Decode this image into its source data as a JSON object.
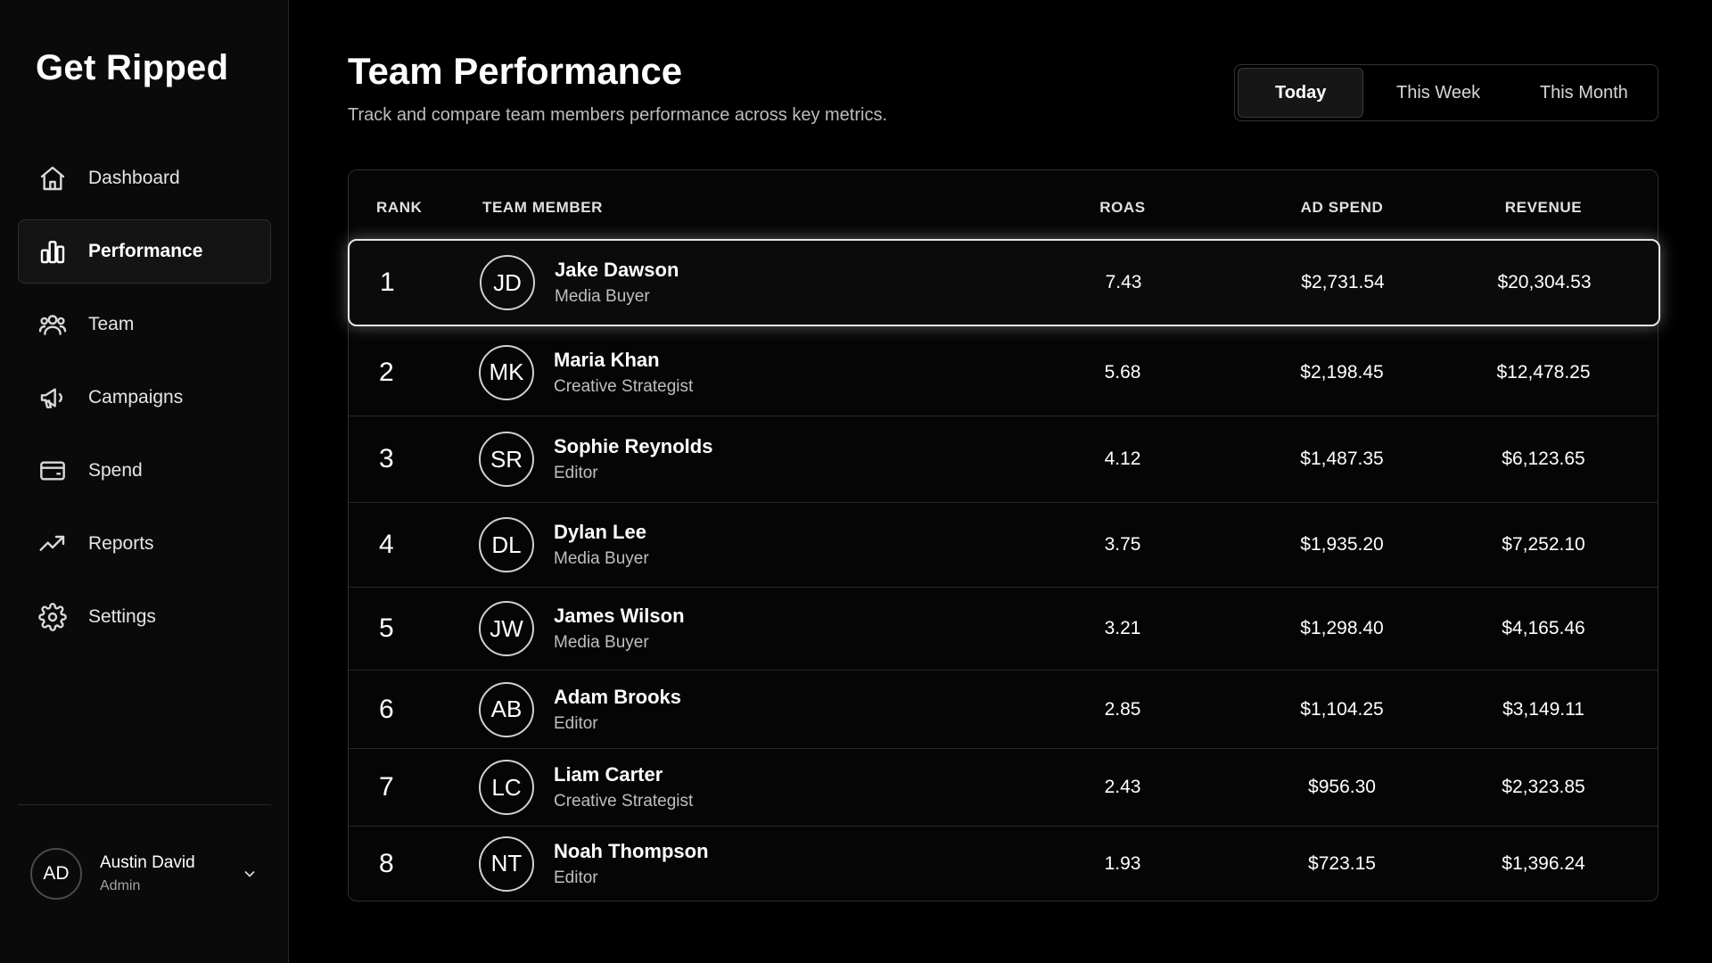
{
  "app": {
    "brand": "Get Ripped"
  },
  "sidebar": {
    "items": [
      {
        "label": "Dashboard",
        "icon": "home-icon",
        "active": false
      },
      {
        "label": "Performance",
        "icon": "bar-chart-icon",
        "active": true
      },
      {
        "label": "Team",
        "icon": "users-icon",
        "active": false
      },
      {
        "label": "Campaigns",
        "icon": "megaphone-icon",
        "active": false
      },
      {
        "label": "Spend",
        "icon": "wallet-icon",
        "active": false
      },
      {
        "label": "Reports",
        "icon": "trending-up-icon",
        "active": false
      },
      {
        "label": "Settings",
        "icon": "gear-icon",
        "active": false
      }
    ],
    "user": {
      "initials": "AD",
      "name": "Austin David",
      "role": "Admin"
    }
  },
  "header": {
    "title": "Team Performance",
    "subtitle": "Track and compare team members performance across key metrics."
  },
  "range": {
    "options": [
      "Today",
      "This Week",
      "This Month"
    ],
    "selected": "Today"
  },
  "table": {
    "columns": {
      "rank": "RANK",
      "member": "TEAM MEMBER",
      "roas": "ROAS",
      "spend": "AD SPEND",
      "revenue": "REVENUE"
    },
    "rows": [
      {
        "rank": "1",
        "initials": "JD",
        "name": "Jake Dawson",
        "role": "Media Buyer",
        "roas": "7.43",
        "spend": "$2,731.54",
        "revenue": "$20,304.53"
      },
      {
        "rank": "2",
        "initials": "MK",
        "name": "Maria Khan",
        "role": "Creative Strategist",
        "roas": "5.68",
        "spend": "$2,198.45",
        "revenue": "$12,478.25"
      },
      {
        "rank": "3",
        "initials": "SR",
        "name": "Sophie Reynolds",
        "role": "Editor",
        "roas": "4.12",
        "spend": "$1,487.35",
        "revenue": "$6,123.65"
      },
      {
        "rank": "4",
        "initials": "DL",
        "name": "Dylan Lee",
        "role": "Media Buyer",
        "roas": "3.75",
        "spend": "$1,935.20",
        "revenue": "$7,252.10"
      },
      {
        "rank": "5",
        "initials": "JW",
        "name": "James Wilson",
        "role": "Media Buyer",
        "roas": "3.21",
        "spend": "$1,298.40",
        "revenue": "$4,165.46"
      },
      {
        "rank": "6",
        "initials": "AB",
        "name": "Adam Brooks",
        "role": "Editor",
        "roas": "2.85",
        "spend": "$1,104.25",
        "revenue": "$3,149.11"
      },
      {
        "rank": "7",
        "initials": "LC",
        "name": "Liam Carter",
        "role": "Creative Strategist",
        "roas": "2.43",
        "spend": "$956.30",
        "revenue": "$2,323.85"
      },
      {
        "rank": "8",
        "initials": "NT",
        "name": "Noah Thompson",
        "role": "Editor",
        "roas": "1.93",
        "spend": "$723.15",
        "revenue": "$1,396.24"
      }
    ]
  },
  "colors": {
    "background": "#000000",
    "sidebar": "#0a0a0a",
    "highlight_border": "#e6e6e6",
    "muted_text": "#bfbfbf"
  }
}
